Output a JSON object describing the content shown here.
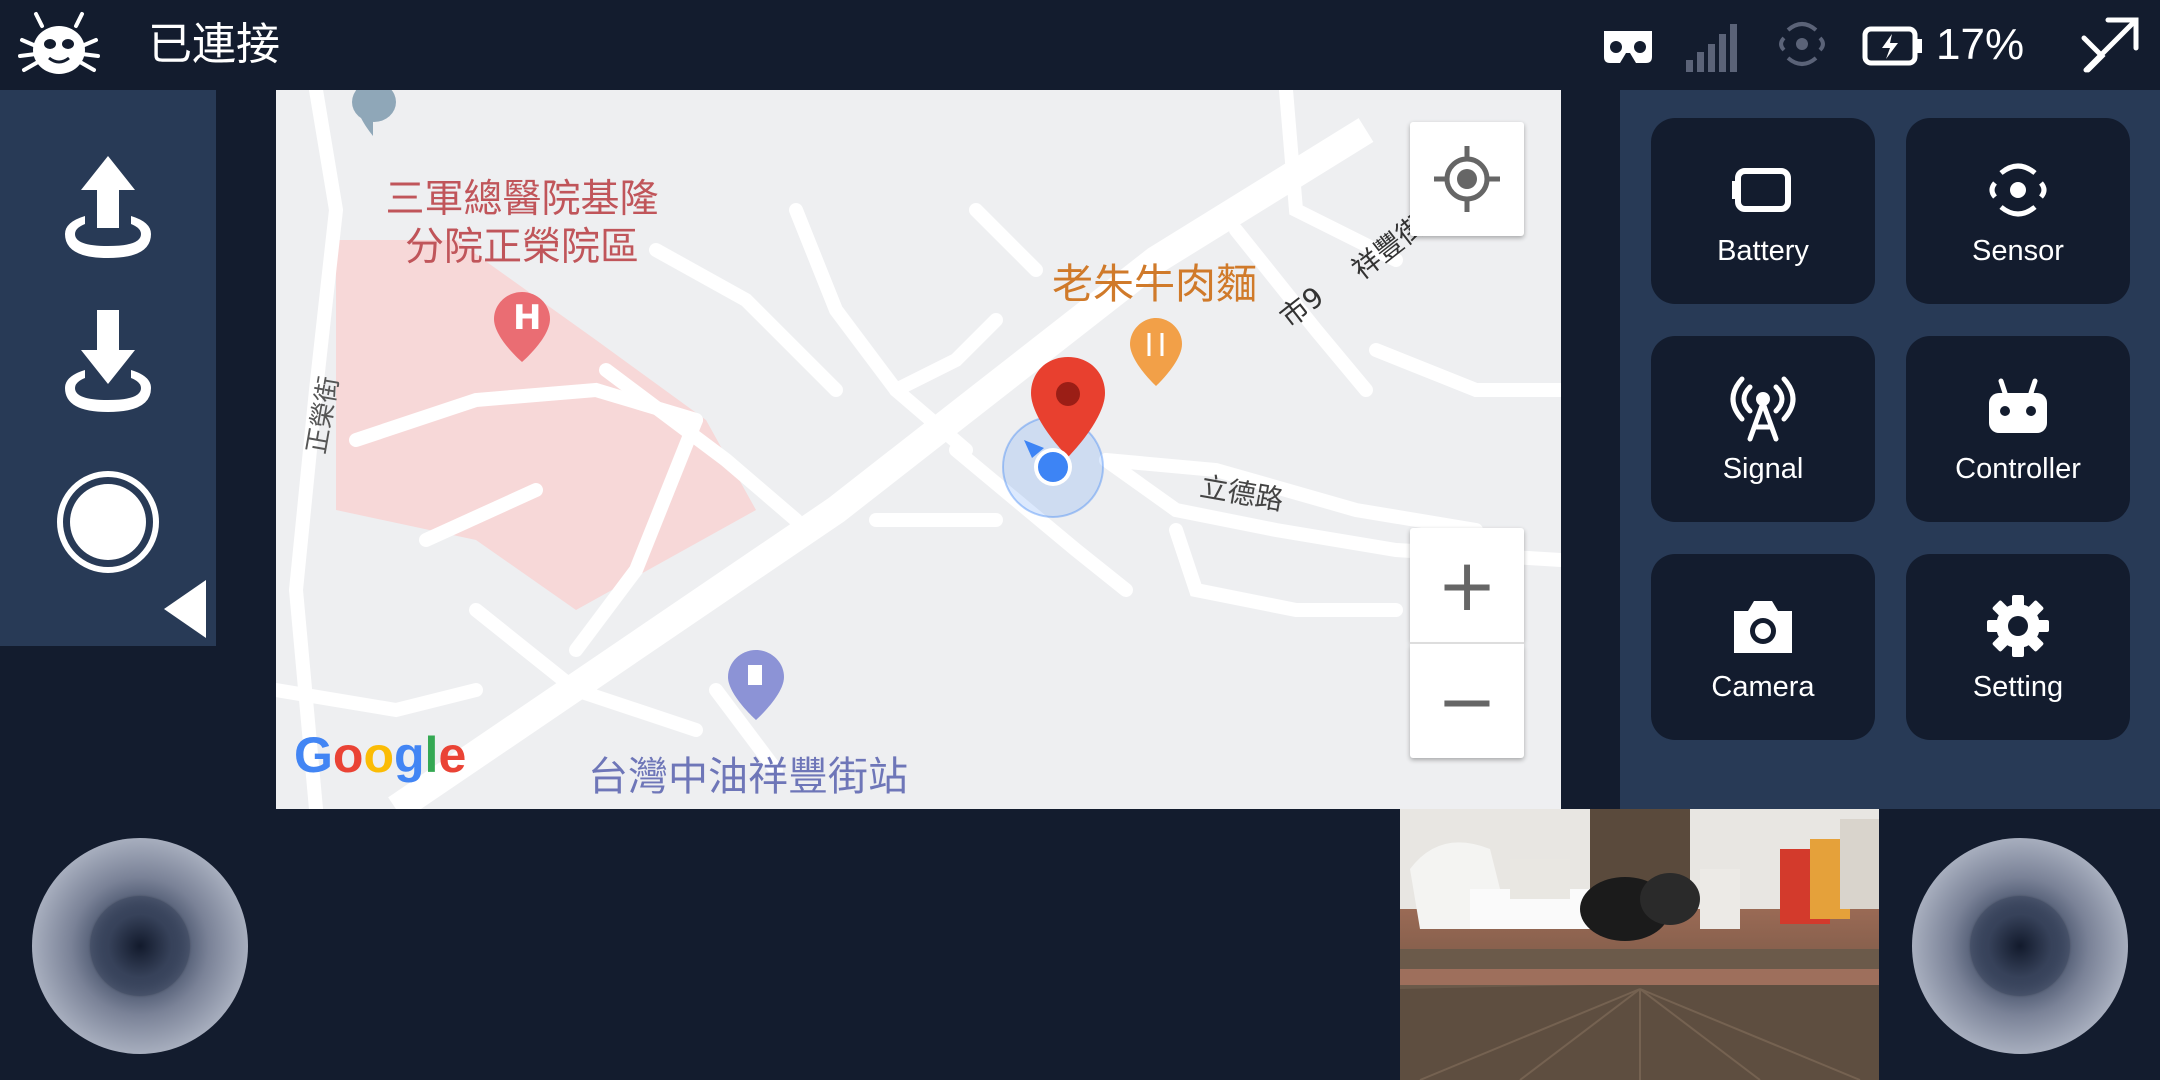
{
  "status_bar": {
    "connection_status": "已連接",
    "battery_percent": "17%",
    "icons": [
      "mascot-icon",
      "vr-headset-icon",
      "signal-bars-icon",
      "sensor-icon",
      "battery-charging-icon",
      "drone-fly-icon"
    ]
  },
  "left_controls": {
    "buttons": [
      "takeoff-icon",
      "land-icon",
      "record-icon",
      "collapse-arrow-icon"
    ]
  },
  "map": {
    "labels": {
      "hospital": "三軍總醫院基隆\n分院正榮院區",
      "restaurant": "老朱牛肉麵",
      "road_shi9": "市9",
      "road_xiangfeng": "祥豐街",
      "road_lide": "立德路",
      "road_zhengrong": "正榮街",
      "gas_station": "台灣中油祥豐街站",
      "hospital_marker": "H"
    },
    "google_logo": [
      "G",
      "o",
      "o",
      "g",
      "l",
      "e"
    ],
    "zoom_in_label": "+",
    "zoom_out_label": "−",
    "colors": {
      "hospital_area": "#f7d8d8",
      "hospital_text": "#c0555a",
      "restaurant_text": "#d07a2a",
      "gas_text": "#6e76b8",
      "destination_pin": "#e8402f",
      "current_location": "#3d84f5"
    }
  },
  "panel_tiles": [
    {
      "label": "Battery",
      "icon": "battery-icon"
    },
    {
      "label": "Sensor",
      "icon": "sensor-icon"
    },
    {
      "label": "Signal",
      "icon": "antenna-icon"
    },
    {
      "label": "Controller",
      "icon": "gamepad-icon"
    },
    {
      "label": "Camera",
      "icon": "camera-icon"
    },
    {
      "label": "Setting",
      "icon": "gear-icon"
    }
  ],
  "colors": {
    "background": "#131c2e",
    "panel": "#283a56"
  }
}
